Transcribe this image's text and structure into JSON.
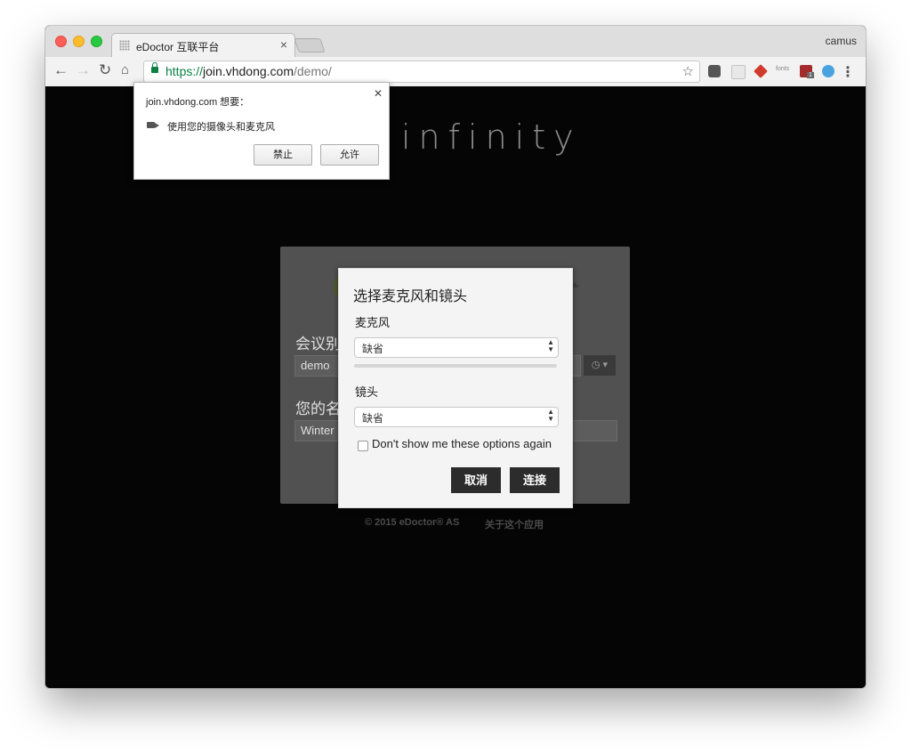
{
  "browser": {
    "tab_title": "eDoctor 互联平台",
    "tab_close": "×",
    "profile_name": "camus",
    "url_scheme": "https://",
    "url_host": "join.vhdong.com",
    "url_path": "/demo/",
    "ext_fonts_label": "fonts",
    "ext_badge_count": "1"
  },
  "page": {
    "logo_text": "infinity",
    "meeting_label": "会议别",
    "meeting_value": "demo",
    "name_label": "您的名",
    "name_value": "Winter",
    "footer_copyright": "© 2015 eDoctor® AS",
    "footer_about": "关于这个应用"
  },
  "media_dialog": {
    "title": "选择麦克风和镜头",
    "microphone_label": "麦克风",
    "microphone_value": "缺省",
    "camera_label": "镜头",
    "camera_value": "缺省",
    "dont_show_label": "Don't show me these options again",
    "cancel_label": "取消",
    "connect_label": "连接"
  },
  "permission_popup": {
    "site_request": "join.vhdong.com 想要：",
    "request_text": "使用您的摄像头和麦克风",
    "block_label": "禁止",
    "allow_label": "允许"
  }
}
